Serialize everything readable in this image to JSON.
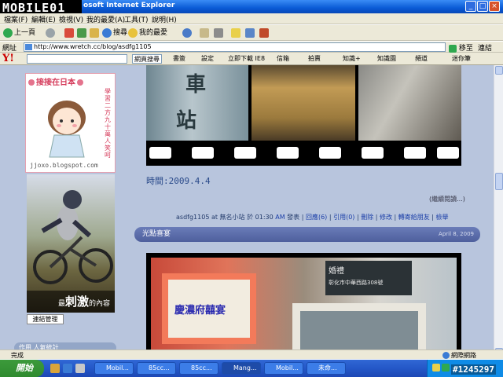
{
  "window": {
    "title": "osoft Internet Explorer",
    "logo_text": "MOBILE01"
  },
  "menu": [
    "檔案(F)",
    "編輯(E)",
    "檢視(V)",
    "我的最愛(A)",
    "工具(T)",
    "說明(H)"
  ],
  "toolbar": {
    "back": "上一頁",
    "search": "搜尋",
    "favorites": "我的最愛"
  },
  "address": {
    "label": "網址",
    "url": "http://www.wretch.cc/blog/asdfg1105",
    "go": "移至",
    "links": "連結"
  },
  "yahoo": {
    "logo": "Y!",
    "search_button": "網頁搜尋",
    "items": [
      "書簽",
      "設定",
      "立即下載 IE8",
      "信箱",
      "拍賣",
      "知識+",
      "知識園",
      "頻道",
      "迷你筆"
    ]
  },
  "sidebar": {
    "panel_title": "接接在日本",
    "panel_side": "學習二方九十萬人笑呵",
    "panel_url": "jjoxo.blogspot.com",
    "ad_caption_prefix": "最",
    "ad_caption_big": "刺激",
    "ad_caption_suffix": "的內容",
    "manage_button": "連結管理",
    "section_heading": "作用 人氣統計"
  },
  "post": {
    "time_label": "時間:2009.4.4",
    "read_more": "(繼續閱讀...)",
    "meta": {
      "author": "asdfg1105",
      "at": "at",
      "category": "無名小站",
      "time": "於 01:30",
      "am": "AM",
      "publish": "發表",
      "reply": "回應(6)",
      "quote": "引用(0)",
      "delete": "刪除",
      "edit": "修改",
      "forward": "轉寄給朋友",
      "report": "檢舉"
    },
    "sign_left": "慶濃府囍宴",
    "sign_right": "婚禮",
    "sign_right_small": "彰化市中華西路308號"
  },
  "next_post": {
    "title": "光點喜宴",
    "date": "April 8, 2009"
  },
  "statusbar": {
    "text": "完成",
    "zone": "網際網路"
  },
  "taskbar": {
    "start": "開始",
    "items": [
      "Mobil...",
      "85cc...",
      "85cc...",
      "Mang...",
      "Mobil...",
      "未命..."
    ],
    "counter": "#1245297"
  }
}
